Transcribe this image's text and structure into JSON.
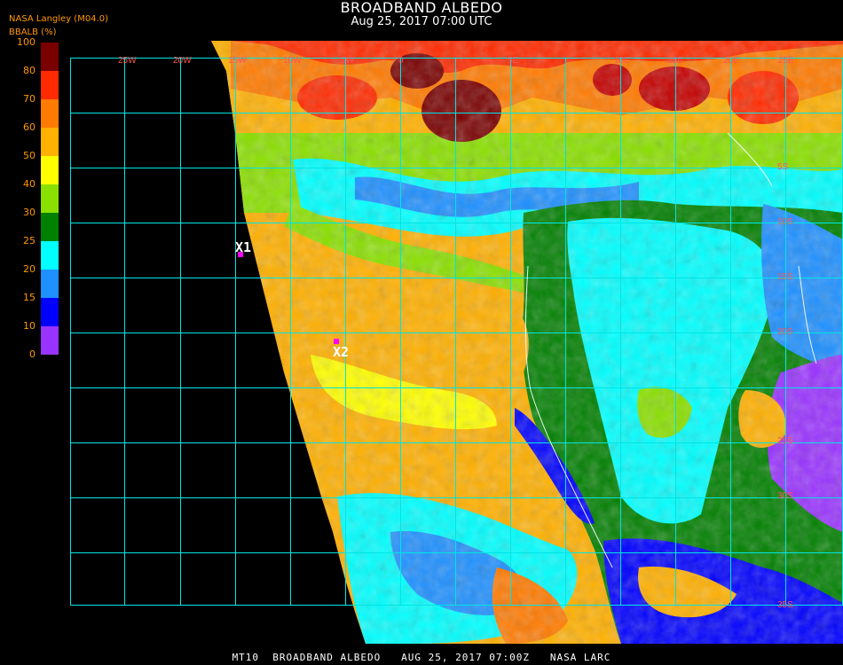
{
  "header": {
    "title": "BROADBAND ALBEDO",
    "subtitle": "Aug 25, 2017 07:00 UTC",
    "agency": "NASA Langley (M04.0)"
  },
  "colorbar": {
    "label": "BBALB (%)",
    "ticks": [
      "100",
      "80",
      "70",
      "60",
      "50",
      "40",
      "30",
      "25",
      "20",
      "15",
      "10",
      "0"
    ],
    "colors": [
      "#7a0000",
      "#c40000",
      "#ff2a00",
      "#ff7a00",
      "#ffb000",
      "#ffff00",
      "#8ae000",
      "#008000",
      "#00ffff",
      "#1e90ff",
      "#0000ff",
      "#9933ff"
    ]
  },
  "map": {
    "grid_color": "#00e5e5",
    "lat_labels": [
      "25W",
      "20W",
      "15W",
      "10W",
      "5W",
      "0",
      "5E",
      "10E",
      "15E",
      "20E",
      "25E"
    ],
    "lon_labels": [
      "5S",
      "10S",
      "15S",
      "20S",
      "25S",
      "30S",
      "35S"
    ],
    "markers": [
      {
        "label": "X1",
        "color": "#ff00ff"
      },
      {
        "label": "X2",
        "color": "#ff00ff"
      }
    ]
  },
  "footer": {
    "text": "MT10  BROADBAND ALBEDO   AUG 25, 2017 07:00Z   NASA LARC"
  }
}
